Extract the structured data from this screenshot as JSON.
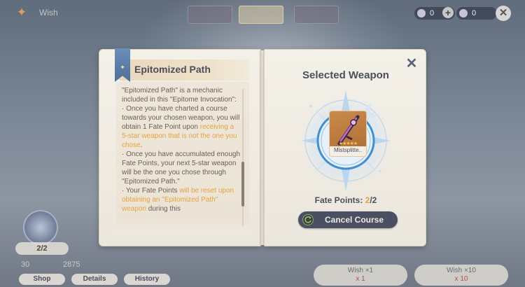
{
  "background": {
    "wish_title": "Wish",
    "currency": [
      {
        "icon": "acquaint-fate-icon",
        "value": "0"
      },
      {
        "icon": "primogem-icon",
        "value": "0"
      }
    ],
    "fate_count": "2/2",
    "stats": [
      "30",
      "2875"
    ],
    "buttons": [
      "Shop",
      "Details",
      "History"
    ],
    "wish_once": {
      "label": "Wish ×1",
      "cost": "x 1"
    },
    "wish_ten": {
      "label": "Wish ×10",
      "cost": "x 10"
    }
  },
  "left_page": {
    "title": "Epitomized Path",
    "description": [
      [
        {
          "t": "\"Epitomized Path\" is a mechanic included in this \"Epitome Invocation\":",
          "hl": false
        }
      ],
      [
        {
          "t": "· Once you have charted a course towards your chosen weapon, you will obtain 1 Fate Point upon ",
          "hl": false
        },
        {
          "t": "receiving a 5-star weapon that is not the one you chose",
          "hl": true
        },
        {
          "t": ".",
          "hl": false
        }
      ],
      [
        {
          "t": "· Once you have accumulated enough Fate Points, your next 5-star weapon will be the one you chose through \"Epitomized Path.\"",
          "hl": false
        }
      ],
      [
        {
          "t": "· Your Fate Points ",
          "hl": false
        },
        {
          "t": "will be reset upon obtaining an \"Epitomized Path\" weapon",
          "hl": true
        },
        {
          "t": " during this",
          "hl": false
        }
      ]
    ]
  },
  "right_page": {
    "title": "Selected Weapon",
    "weapon": {
      "name": "Mistsplitte..",
      "stars": "★★★★★",
      "rarity": 5
    },
    "fate_points_label": "Fate Points: ",
    "fate_points_current": "2",
    "fate_points_max": "/2",
    "cancel_button": "Cancel Course"
  },
  "colors": {
    "highlight": "#e8a33c",
    "title_text": "#4b4f5c",
    "button_bg": "#4a5064",
    "card_bg": "#c98a4a"
  }
}
